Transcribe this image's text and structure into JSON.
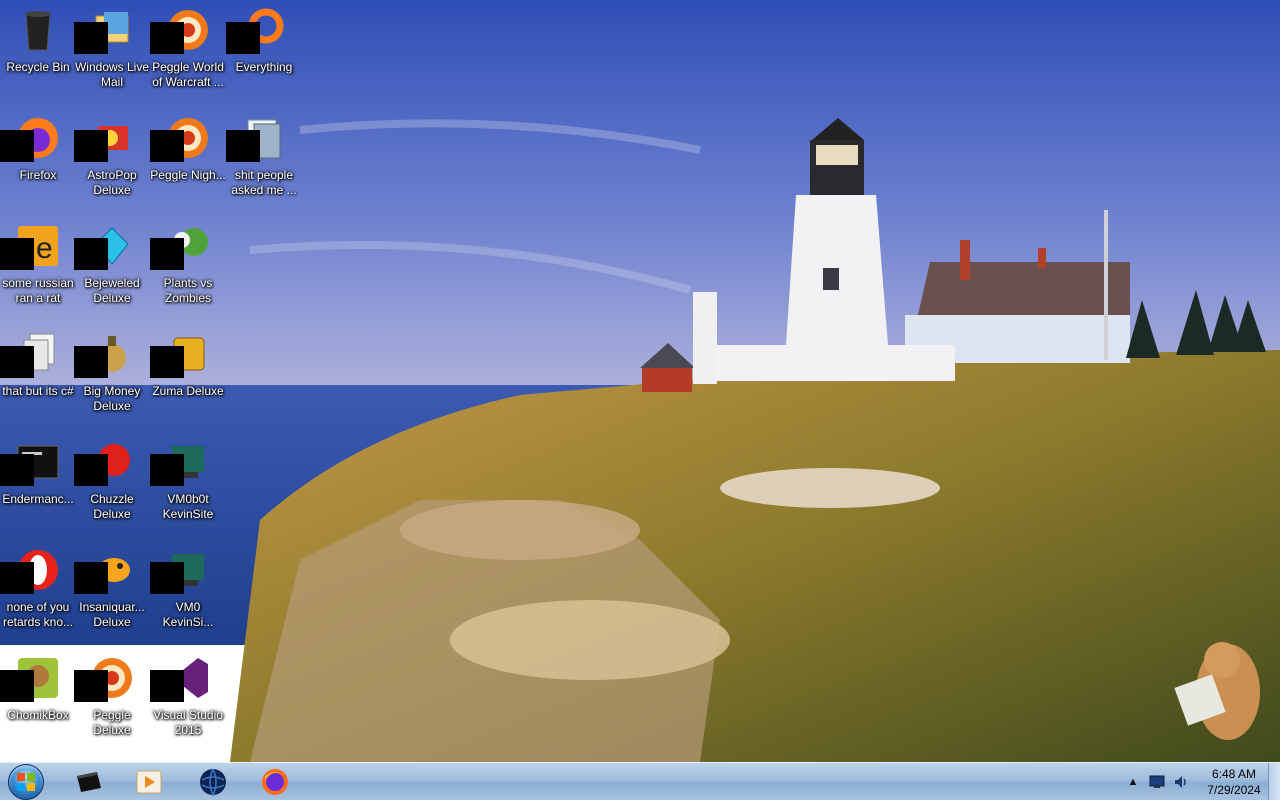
{
  "desktop": {
    "icons": [
      {
        "label": "Recycle Bin",
        "icon": "recycle-bin-icon"
      },
      {
        "label": "Windows Live Mail",
        "icon": "mail-icon"
      },
      {
        "label": "Peggle World of Warcraft ...",
        "icon": "peggle-icon"
      },
      {
        "label": "Everything",
        "icon": "search-icon"
      },
      {
        "label": "Firefox",
        "icon": "firefox-icon"
      },
      {
        "label": "AstroPop Deluxe",
        "icon": "astropop-icon"
      },
      {
        "label": "Peggle Nigh...",
        "icon": "peggle-icon"
      },
      {
        "label": "shit people asked me ...",
        "icon": "folder-icon"
      },
      {
        "label": "some russian ran a rat",
        "icon": "java-icon"
      },
      {
        "label": "Bejeweled Deluxe",
        "icon": "gem-icon"
      },
      {
        "label": "Plants vs Zombies",
        "icon": "plant-icon"
      },
      {
        "label": "that but its c#",
        "icon": "files-icon"
      },
      {
        "label": "Big Money Deluxe",
        "icon": "money-icon"
      },
      {
        "label": "Zuma Deluxe",
        "icon": "zuma-icon"
      },
      {
        "label": "Endermanc...",
        "icon": "terminal-icon"
      },
      {
        "label": "Chuzzle Deluxe",
        "icon": "chuzzle-icon"
      },
      {
        "label": "VM0b0t KevinSite",
        "icon": "vm-icon"
      },
      {
        "label": "none of you retards kno...",
        "icon": "opera-icon"
      },
      {
        "label": "Insaniquar... Deluxe",
        "icon": "fish-icon"
      },
      {
        "label": "VM0 KevinSi...",
        "icon": "vm-icon"
      },
      {
        "label": "ChomikBox",
        "icon": "chomik-icon"
      },
      {
        "label": "Peggle Deluxe",
        "icon": "peggle-icon"
      },
      {
        "label": "Visual Studio 2015",
        "icon": "visual-studio-icon"
      }
    ]
  },
  "taskbar": {
    "start": {
      "icon": "windows-logo-icon"
    },
    "pinned": [
      {
        "name": "terminal",
        "icon": "terminal-icon"
      },
      {
        "name": "media-player",
        "icon": "media-player-icon"
      },
      {
        "name": "globe",
        "icon": "globe-icon"
      },
      {
        "name": "firefox",
        "icon": "firefox-icon"
      }
    ],
    "tray": {
      "show_hidden": "▲",
      "clock_time": "6:48 AM",
      "clock_date": "7/29/2024"
    }
  },
  "colors": {
    "sky_top": "#3b57b8",
    "sky_horizon": "#9aa9d8",
    "sea": "#2a4c9c",
    "grass": "#8a7a2a",
    "taskbar": "#a7c3e1"
  }
}
